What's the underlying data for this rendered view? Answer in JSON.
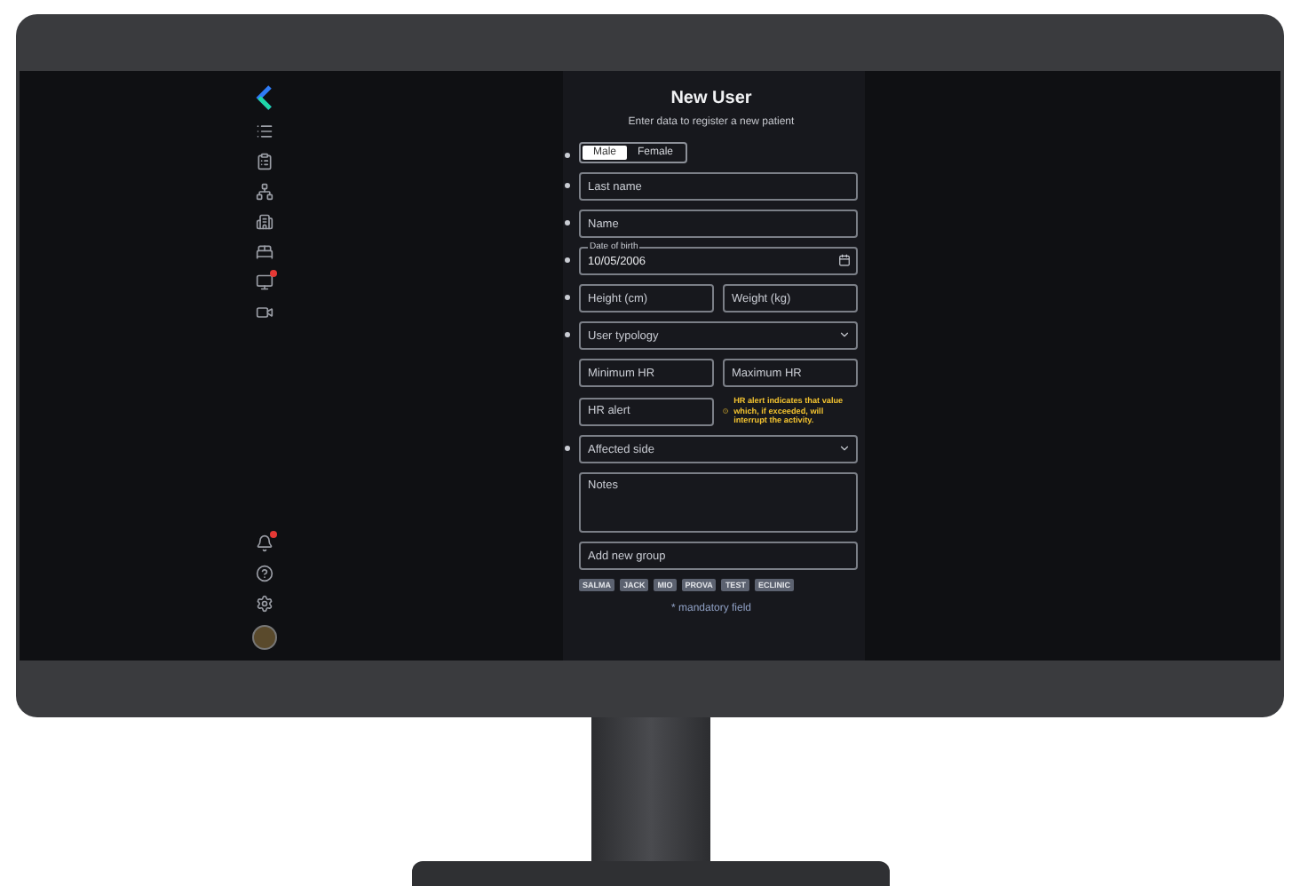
{
  "sidebar": {
    "items": [
      {
        "badge": false
      },
      {
        "badge": false
      },
      {
        "badge": false
      },
      {
        "badge": false
      },
      {
        "badge": false
      },
      {
        "badge": true
      },
      {
        "badge": false
      }
    ],
    "bottom": [
      {
        "badge": true
      },
      {
        "badge": false
      },
      {
        "badge": false
      },
      {
        "badge": false
      }
    ]
  },
  "form": {
    "title": "New User",
    "subtitle": "Enter data to register a new patient",
    "rows": [
      {
        "kind": "toggle",
        "required": true,
        "options": [
          {
            "label": "Male",
            "selected": true
          },
          {
            "label": "Female",
            "selected": false
          }
        ]
      },
      {
        "kind": "input",
        "required": true,
        "placeholder": "Last name"
      },
      {
        "kind": "input",
        "required": true,
        "placeholder": "Name"
      },
      {
        "kind": "date",
        "required": true,
        "label": "Date of birth",
        "value": "10/05/2006"
      },
      {
        "kind": "pair",
        "required": true,
        "fields": [
          {
            "placeholder": "Height (cm)"
          },
          {
            "placeholder": "Weight (kg)"
          }
        ]
      },
      {
        "kind": "select",
        "required": true,
        "placeholder": "User typology"
      },
      {
        "kind": "pair",
        "required": false,
        "fields": [
          {
            "placeholder": "Minimum HR"
          },
          {
            "placeholder": "Maximum HR"
          }
        ]
      },
      {
        "kind": "alert",
        "required": false,
        "placeholder": "HR alert",
        "note": "HR alert indicates that value which, if exceeded, will interrupt the activity."
      },
      {
        "kind": "select",
        "required": true,
        "placeholder": "Affected side"
      },
      {
        "kind": "textarea",
        "required": false,
        "placeholder": "Notes"
      },
      {
        "kind": "input",
        "required": false,
        "placeholder": "Add new group"
      }
    ],
    "tags": [
      "SALMA",
      "JACK",
      "MIO",
      "PROVA",
      "TEST",
      "ECLINIC"
    ],
    "footer": "* mandatory field"
  }
}
